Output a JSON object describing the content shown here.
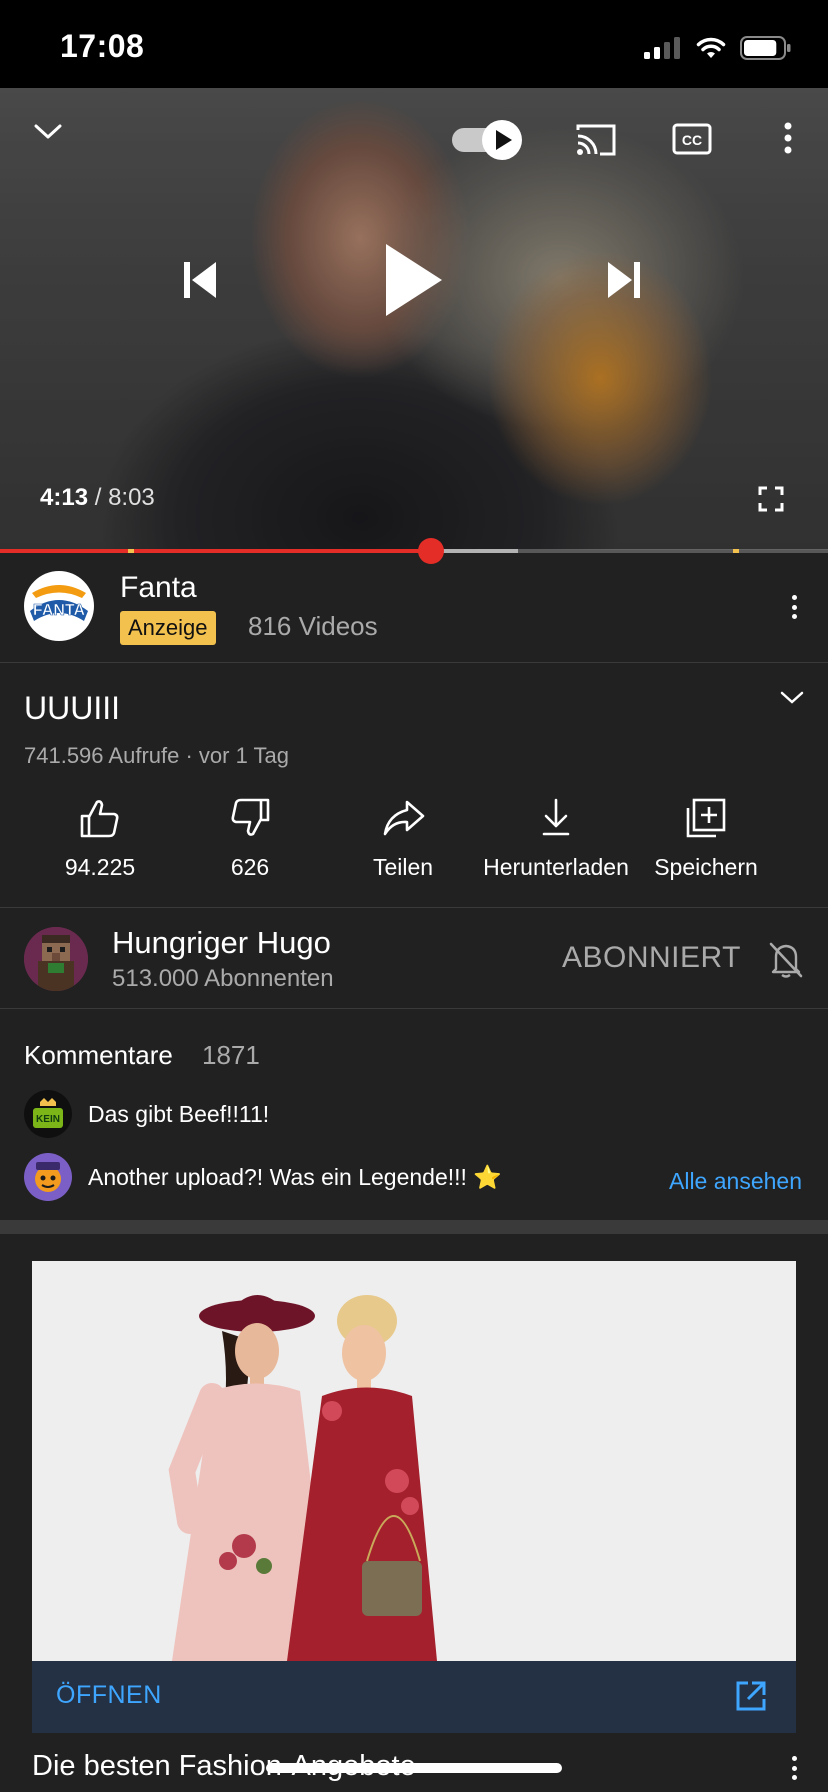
{
  "status_bar": {
    "time": "17:08",
    "battery_level": 0.85
  },
  "player": {
    "current_time": "4:13",
    "separator": "/",
    "total_time": "8:03",
    "progress_fraction": 0.52,
    "buffer_fraction": 0.625,
    "autoplay_on": true,
    "ad_marker_fractions": [
      0.155,
      0.885
    ],
    "icons": [
      "collapse-chevron-icon",
      "autoplay-toggle",
      "cast-icon",
      "captions-icon",
      "more-vert-icon",
      "previous-icon",
      "play-icon",
      "next-icon",
      "fullscreen-icon"
    ]
  },
  "ad_channel": {
    "name": "Fanta",
    "logo_text": "FANTA",
    "badge": "Anzeige",
    "videos": "816 Videos"
  },
  "video": {
    "title": "UUUIII",
    "meta": "741.596 Aufrufe · vor 1 Tag"
  },
  "actions": [
    {
      "label": "94.225",
      "icon": "thumbs-up-icon"
    },
    {
      "label": "626",
      "icon": "thumbs-down-icon"
    },
    {
      "label": "Teilen",
      "icon": "share-icon"
    },
    {
      "label": "Herunterladen",
      "icon": "download-icon"
    },
    {
      "label": "Speichern",
      "icon": "save-playlist-icon"
    }
  ],
  "channel": {
    "name": "Hungriger Hugo",
    "subscribers": "513.000 Abonnenten",
    "subscribe_label": "ABONNIERT"
  },
  "comments": {
    "header": "Kommentare",
    "count": "1871",
    "items": [
      {
        "text": "Das gibt Beef!!11!",
        "avatar_text": "KEIN"
      },
      {
        "text": "Another upload?! Was ein Legende!!! ⭐"
      }
    ],
    "see_all": "Alle ansehen"
  },
  "ad_card": {
    "open_label": "ÖFFNEN",
    "title": "Die besten Fashion-Angebote"
  },
  "colors": {
    "accent_red": "#e52d27",
    "ad_yellow": "#f2c14e",
    "link_blue": "#3ea6ff",
    "background": "#212121"
  }
}
